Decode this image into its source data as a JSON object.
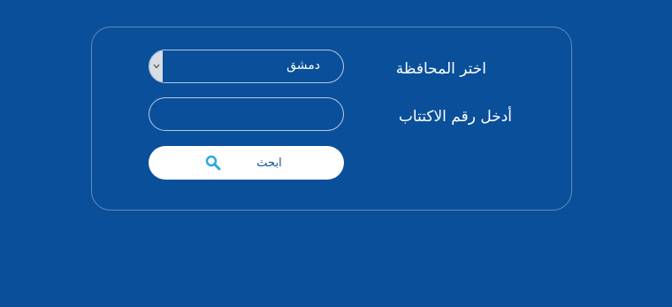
{
  "colors": {
    "background": "#0a4f9a",
    "text": "#ffffff",
    "button_bg": "#ffffff",
    "button_text": "#0a4f9a",
    "search_icon": "#2aa7df"
  },
  "form": {
    "governorate_label": "اختر المحافظة",
    "governorate_selected": "دمشق",
    "subscription_label": "أدخل رقم الاكتتاب",
    "subscription_value": "",
    "search_button_label": "ابحث",
    "search_icon": "search-icon",
    "dropdown_icon": "chevron-down-icon"
  }
}
